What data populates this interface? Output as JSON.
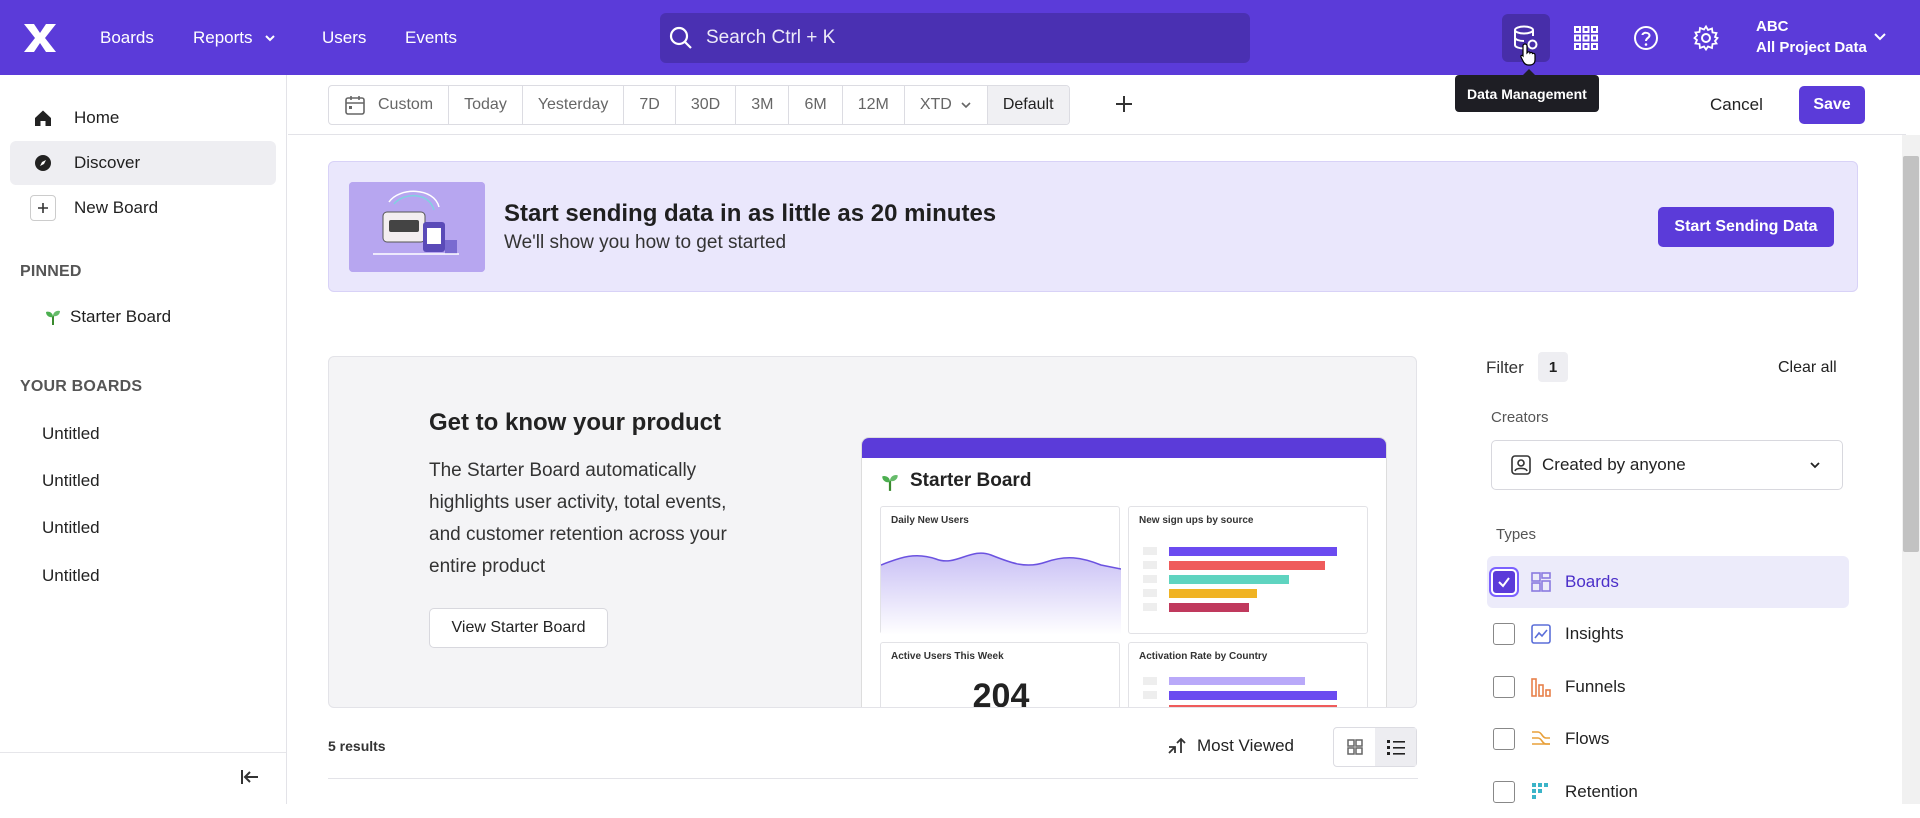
{
  "topbar": {
    "nav": [
      {
        "label": "Boards"
      },
      {
        "label": "Reports"
      },
      {
        "label": "Users"
      },
      {
        "label": "Events"
      }
    ],
    "search_placeholder": "Search  Ctrl + K",
    "account": {
      "name": "ABC",
      "project": "All Project Data"
    },
    "tooltip": "Data Management",
    "icons": [
      "data-management-icon",
      "apps-grid-icon",
      "help-icon",
      "settings-icon"
    ]
  },
  "sidebar": {
    "items": [
      {
        "label": "Home"
      },
      {
        "label": "Discover"
      },
      {
        "label": "New Board"
      }
    ],
    "pinned_heading": "PINNED",
    "pinned": [
      {
        "label": "Starter Board"
      }
    ],
    "your_boards_heading": "YOUR BOARDS",
    "boards": [
      {
        "label": "Untitled"
      },
      {
        "label": "Untitled"
      },
      {
        "label": "Untitled"
      },
      {
        "label": "Untitled"
      }
    ]
  },
  "datebar": {
    "segments": [
      "Custom",
      "Today",
      "Yesterday",
      "7D",
      "30D",
      "3M",
      "6M",
      "12M",
      "XTD",
      "Default"
    ],
    "cancel": "Cancel",
    "save": "Save"
  },
  "banner": {
    "title": "Start sending data in as little as 20 minutes",
    "subtitle": "We'll show you how to get started",
    "button": "Start Sending Data"
  },
  "promo": {
    "title": "Get to know your product",
    "description": "The Starter Board automatically highlights user activity, total events, and customer retention across your entire product",
    "button": "View Starter Board",
    "mock": {
      "title": "Starter Board",
      "cards": [
        "Daily New Users",
        "New sign ups by source",
        "Active Users This Week",
        "Activation Rate by Country"
      ],
      "active_users_value": "204"
    }
  },
  "results": {
    "count_label": "5 results",
    "sort_label": "Most Viewed"
  },
  "filters": {
    "label": "Filter",
    "count": "1",
    "clear": "Clear all",
    "creators_label": "Creators",
    "creators_value": "Created by anyone",
    "types_label": "Types",
    "types": [
      {
        "label": "Boards",
        "checked": true
      },
      {
        "label": "Insights",
        "checked": false
      },
      {
        "label": "Funnels",
        "checked": false
      },
      {
        "label": "Flows",
        "checked": false
      },
      {
        "label": "Retention",
        "checked": false
      }
    ]
  },
  "colors": {
    "brand": "#5b3bd9",
    "banner_bg": "#eae7fc"
  }
}
